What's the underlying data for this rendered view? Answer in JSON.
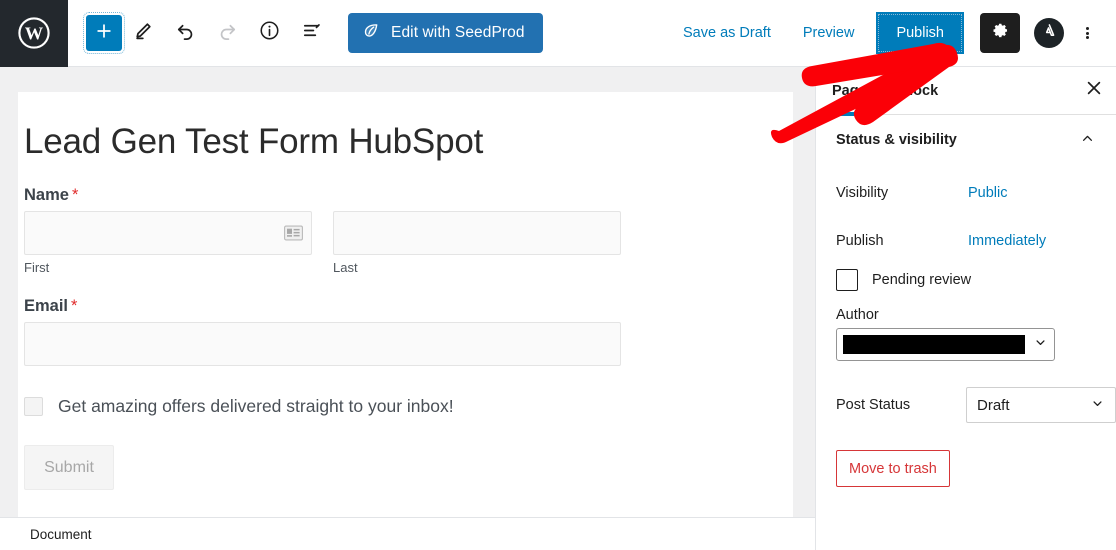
{
  "toolbar": {
    "wp_logo_name": "wordpress-logo",
    "add_block_label": "+",
    "edit_tool_name": "pencil-icon",
    "undo_name": "undo-icon",
    "redo_name": "redo-icon",
    "info_name": "info-icon",
    "list_view_name": "list-view-icon",
    "seedprod_label": "Edit with SeedProd",
    "save_draft_label": "Save as Draft",
    "preview_label": "Preview",
    "publish_label": "Publish",
    "settings_name": "gear-icon",
    "avatar_name": "user-avatar",
    "more_menu_name": "kebab-menu-icon"
  },
  "editor": {
    "post_title": "Lead Gen Test Form HubSpot",
    "form": {
      "name_field": {
        "label": "Name",
        "required_mark": "*",
        "first": {
          "value": "",
          "placeholder": "",
          "sublabel": "First"
        },
        "last": {
          "value": "",
          "placeholder": "",
          "sublabel": "Last"
        }
      },
      "email_field": {
        "label": "Email",
        "required_mark": "*",
        "value": "",
        "placeholder": ""
      },
      "opt_in": {
        "label": "Get amazing offers delivered straight to your inbox!",
        "checked": false
      },
      "submit_label": "Submit"
    }
  },
  "sidebar": {
    "tabs": [
      {
        "label": "Page",
        "active": true
      },
      {
        "label": "Block",
        "active": false
      }
    ],
    "close_name": "close-icon",
    "panel": {
      "title": "Status & visibility",
      "collapse_name": "chevron-up-icon",
      "visibility": {
        "key": "Visibility",
        "value": "Public"
      },
      "publish": {
        "key": "Publish",
        "value": "Immediately"
      },
      "pending_review": {
        "label": "Pending review",
        "checked": false
      },
      "author": {
        "label": "Author",
        "value": "",
        "redacted": true
      },
      "post_status": {
        "key": "Post Status",
        "value": "Draft"
      },
      "move_to_trash_label": "Move to trash"
    }
  },
  "bottom_bar": {
    "breadcrumb": "Document"
  },
  "annotation": {
    "type": "arrow",
    "color": "#fb0007",
    "points_to": "publish-button"
  },
  "colors": {
    "wp_blue": "#007cba",
    "seedprod_blue": "#2271b1",
    "danger_red": "#d63638",
    "annotation_red": "#fb0007",
    "required_red": "#e02b2b",
    "chrome_dark": "#23282d",
    "canvas_gray": "#f0f0f1"
  }
}
